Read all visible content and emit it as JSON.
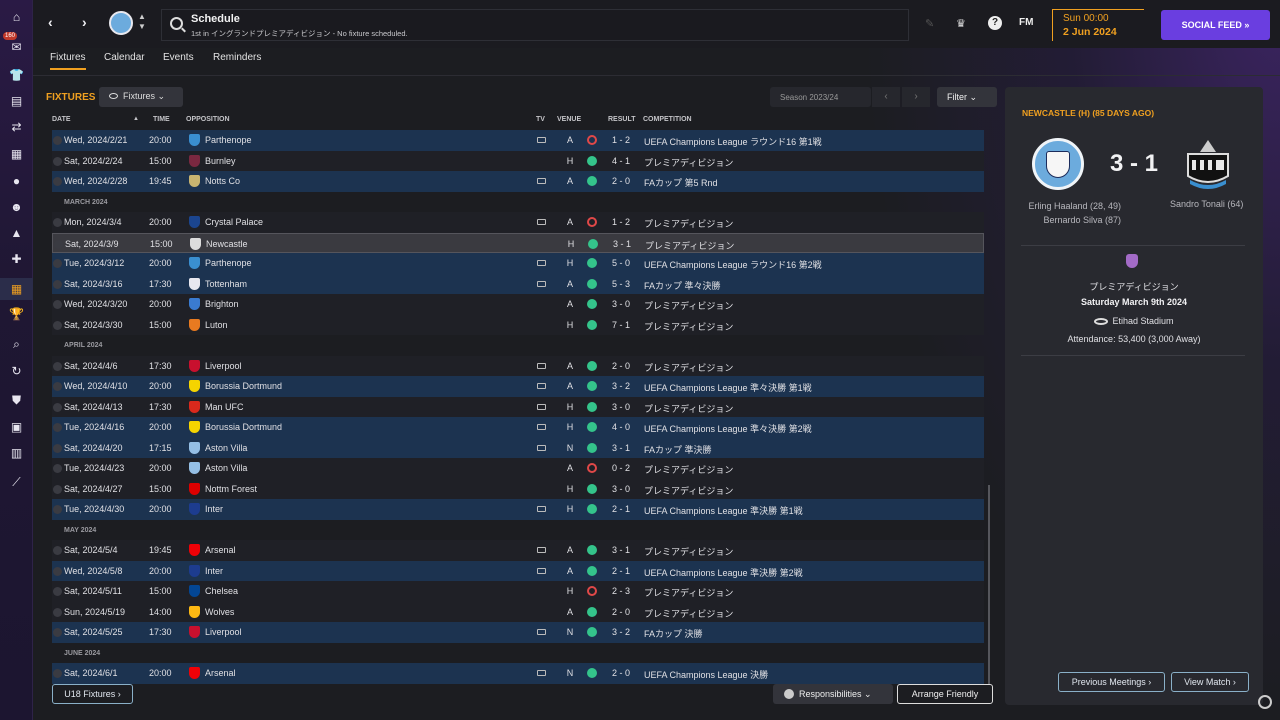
{
  "header": {
    "title": "Schedule",
    "subtitle": "1st in イングランドプレミアディビジョン - No fixture scheduled.",
    "fm_logo": "FM",
    "date_day": "Sun 00:00",
    "date": "2 Jun 2024",
    "social_feed": "SOCIAL FEED  »",
    "help": "?",
    "badge_count": "160"
  },
  "tabs": [
    "Fixtures",
    "Calendar",
    "Events",
    "Reminders"
  ],
  "fixtures": {
    "title": "FIXTURES",
    "dropdown": "Fixtures",
    "season": "Season 2023/24",
    "filter": "Filter",
    "columns": {
      "date": "DATE",
      "time": "TIME",
      "opposition": "OPPOSITION",
      "tv": "TV",
      "venue": "VENUE",
      "result": "RESULT",
      "competition": "COMPETITION"
    },
    "rows": [
      {
        "type": "f",
        "date": "Wed, 2024/2/21",
        "time": "20:00",
        "opp": "Parthenope",
        "crest": "#3a8fd0",
        "tv": true,
        "venue": "A",
        "res": "L",
        "score": "1 - 2",
        "comp": "UEFA Champions League ラウンド16 第1戦",
        "bg": "blue"
      },
      {
        "type": "f",
        "date": "Sat, 2024/2/24",
        "time": "15:00",
        "opp": "Burnley",
        "crest": "#7a2840",
        "tv": false,
        "venue": "H",
        "res": "W",
        "score": "4 - 1",
        "comp": "プレミアディビジョン",
        "bg": "dark"
      },
      {
        "type": "f",
        "date": "Wed, 2024/2/28",
        "time": "19:45",
        "opp": "Notts Co",
        "crest": "#c8b470",
        "tv": true,
        "venue": "A",
        "res": "W",
        "score": "2 - 0",
        "comp": "FAカップ 第5 Rnd",
        "bg": "blue"
      },
      {
        "type": "h",
        "label": "MARCH 2024"
      },
      {
        "type": "f",
        "date": "Mon, 2024/3/4",
        "time": "20:00",
        "opp": "Crystal Palace",
        "crest": "#1b458f",
        "tv": true,
        "venue": "A",
        "res": "L",
        "score": "1 - 2",
        "comp": "プレミアディビジョン",
        "bg": "dark"
      },
      {
        "type": "f",
        "date": "Sat, 2024/3/9",
        "time": "15:00",
        "opp": "Newcastle",
        "crest": "#dddddd",
        "tv": false,
        "venue": "H",
        "res": "W",
        "score": "3 - 1",
        "comp": "プレミアディビジョン",
        "bg": "sel"
      },
      {
        "type": "f",
        "date": "Tue, 2024/3/12",
        "time": "20:00",
        "opp": "Parthenope",
        "crest": "#3a8fd0",
        "tv": true,
        "venue": "H",
        "res": "W",
        "score": "5 - 0",
        "comp": "UEFA Champions League ラウンド16 第2戦",
        "bg": "blue"
      },
      {
        "type": "f",
        "date": "Sat, 2024/3/16",
        "time": "17:30",
        "opp": "Tottenham",
        "crest": "#e8e8f0",
        "tv": true,
        "venue": "A",
        "res": "W",
        "score": "5 - 3",
        "comp": "FAカップ 準々決勝",
        "bg": "blue"
      },
      {
        "type": "f",
        "date": "Wed, 2024/3/20",
        "time": "20:00",
        "opp": "Brighton",
        "crest": "#3a7bd0",
        "tv": false,
        "venue": "A",
        "res": "W",
        "score": "3 - 0",
        "comp": "プレミアディビジョン",
        "bg": "dark"
      },
      {
        "type": "f",
        "date": "Sat, 2024/3/30",
        "time": "15:00",
        "opp": "Luton",
        "crest": "#e87a20",
        "tv": false,
        "venue": "H",
        "res": "W",
        "score": "7 - 1",
        "comp": "プレミアディビジョン",
        "bg": "dark"
      },
      {
        "type": "h",
        "label": "APRIL 2024"
      },
      {
        "type": "f",
        "date": "Sat, 2024/4/6",
        "time": "17:30",
        "opp": "Liverpool",
        "crest": "#c8102e",
        "tv": true,
        "venue": "A",
        "res": "W",
        "score": "2 - 0",
        "comp": "プレミアディビジョン",
        "bg": "dark"
      },
      {
        "type": "f",
        "date": "Wed, 2024/4/10",
        "time": "20:00",
        "opp": "Borussia Dortmund",
        "crest": "#f5d400",
        "tv": true,
        "venue": "A",
        "res": "W",
        "score": "3 - 2",
        "comp": "UEFA Champions League 準々決勝 第1戦",
        "bg": "blue"
      },
      {
        "type": "f",
        "date": "Sat, 2024/4/13",
        "time": "17:30",
        "opp": "Man UFC",
        "crest": "#da291c",
        "tv": true,
        "venue": "H",
        "res": "W",
        "score": "3 - 0",
        "comp": "プレミアディビジョン",
        "bg": "dark"
      },
      {
        "type": "f",
        "date": "Tue, 2024/4/16",
        "time": "20:00",
        "opp": "Borussia Dortmund",
        "crest": "#f5d400",
        "tv": true,
        "venue": "H",
        "res": "W",
        "score": "4 - 0",
        "comp": "UEFA Champions League 準々決勝 第2戦",
        "bg": "blue"
      },
      {
        "type": "f",
        "date": "Sat, 2024/4/20",
        "time": "17:15",
        "opp": "Aston Villa",
        "crest": "#95bfe5",
        "tv": true,
        "venue": "N",
        "res": "W",
        "score": "3 - 1",
        "comp": "FAカップ 準決勝",
        "bg": "blue"
      },
      {
        "type": "f",
        "date": "Tue, 2024/4/23",
        "time": "20:00",
        "opp": "Aston Villa",
        "crest": "#95bfe5",
        "tv": false,
        "venue": "A",
        "res": "L",
        "score": "0 - 2",
        "comp": "プレミアディビジョン",
        "bg": "dark"
      },
      {
        "type": "f",
        "date": "Sat, 2024/4/27",
        "time": "15:00",
        "opp": "Nottm Forest",
        "crest": "#dd0000",
        "tv": false,
        "venue": "H",
        "res": "W",
        "score": "3 - 0",
        "comp": "プレミアディビジョン",
        "bg": "dark"
      },
      {
        "type": "f",
        "date": "Tue, 2024/4/30",
        "time": "20:00",
        "opp": "Inter",
        "crest": "#1d3c8f",
        "tv": true,
        "venue": "H",
        "res": "W",
        "score": "2 - 1",
        "comp": "UEFA Champions League 準決勝 第1戦",
        "bg": "blue"
      },
      {
        "type": "h",
        "label": "MAY 2024"
      },
      {
        "type": "f",
        "date": "Sat, 2024/5/4",
        "time": "19:45",
        "opp": "Arsenal",
        "crest": "#ef0107",
        "tv": true,
        "venue": "A",
        "res": "W",
        "score": "3 - 1",
        "comp": "プレミアディビジョン",
        "bg": "dark"
      },
      {
        "type": "f",
        "date": "Wed, 2024/5/8",
        "time": "20:00",
        "opp": "Inter",
        "crest": "#1d3c8f",
        "tv": true,
        "venue": "A",
        "res": "W",
        "score": "2 - 1",
        "comp": "UEFA Champions League 準決勝 第2戦",
        "bg": "blue"
      },
      {
        "type": "f",
        "date": "Sat, 2024/5/11",
        "time": "15:00",
        "opp": "Chelsea",
        "crest": "#034694",
        "tv": false,
        "venue": "H",
        "res": "L",
        "score": "2 - 3",
        "comp": "プレミアディビジョン",
        "bg": "dark"
      },
      {
        "type": "f",
        "date": "Sun, 2024/5/19",
        "time": "14:00",
        "opp": "Wolves",
        "crest": "#fdb913",
        "tv": false,
        "venue": "A",
        "res": "W",
        "score": "2 - 0",
        "comp": "プレミアディビジョン",
        "bg": "dark"
      },
      {
        "type": "f",
        "date": "Sat, 2024/5/25",
        "time": "17:30",
        "opp": "Liverpool",
        "crest": "#c8102e",
        "tv": true,
        "venue": "N",
        "res": "W",
        "score": "3 - 2",
        "comp": "FAカップ 決勝",
        "bg": "blue"
      },
      {
        "type": "h",
        "label": "JUNE 2024"
      },
      {
        "type": "f",
        "date": "Sat, 2024/6/1",
        "time": "20:00",
        "opp": "Arsenal",
        "crest": "#ef0107",
        "tv": true,
        "venue": "N",
        "res": "W",
        "score": "2 - 0",
        "comp": "UEFA Champions League 決勝",
        "bg": "blue"
      }
    ],
    "u18": "U18 Fixtures  ›",
    "responsibilities": "Responsibilities",
    "arrange_friendly": "Arrange Friendly"
  },
  "panel": {
    "heading": "NEWCASTLE (H) (85 DAYS AGO)",
    "score": "3 - 1",
    "home_scorers": [
      "Erling Haaland (28, 49)",
      "Bernardo Silva (87)"
    ],
    "away_scorers": [
      "Sandro Tonali (64)"
    ],
    "competition": "プレミアディビジョン",
    "match_date": "Saturday March 9th 2024",
    "stadium": "Etihad Stadium",
    "attendance": "Attendance: 53,400 (3,000 Away)",
    "previous_meetings": "Previous Meetings  ›",
    "view_match": "View Match  ›"
  },
  "colors": {
    "accent": "#f0a020",
    "win": "#34c48b",
    "loss": "#e04848",
    "social": "#6a3ee0",
    "row_blue": "#1c3350"
  },
  "icons": [
    "back-icon",
    "forward-icon",
    "search-icon",
    "edit-icon",
    "trophy-icon",
    "help-icon",
    "tv-icon",
    "eye-icon",
    "stadium-icon"
  ]
}
